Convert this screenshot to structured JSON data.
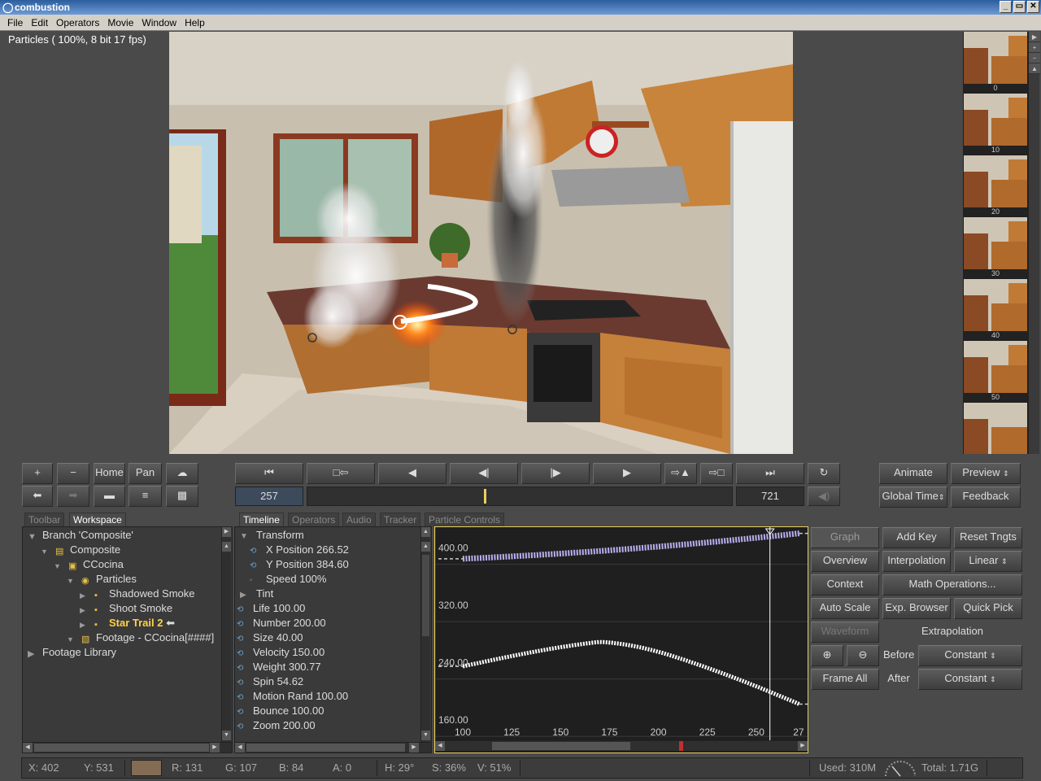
{
  "app": {
    "title": "combustion"
  },
  "menu": [
    "File",
    "Edit",
    "Operators",
    "Movie",
    "Window",
    "Help"
  ],
  "viewer": {
    "info": "Particles ( 100%, 8 bit  17 fps)"
  },
  "thumbnails": {
    "labels": [
      "0",
      "10",
      "20",
      "30",
      "40",
      "50"
    ]
  },
  "viewer_tools": {
    "home": "Home",
    "pan": "Pan",
    "plus": "+",
    "minus": "−"
  },
  "transport": {
    "current_frame": "257",
    "end_frame": "721",
    "current_frame_fraction": 0.416
  },
  "right_buttons": {
    "animate": "Animate",
    "preview": "Preview",
    "global_time": "Global Time",
    "feedback": "Feedback"
  },
  "workspace": {
    "tabs": [
      "Toolbar",
      "Workspace"
    ],
    "tree": [
      {
        "label": "Branch 'Composite'",
        "indent": 0,
        "icon": "triangle-down-icon"
      },
      {
        "label": "Composite",
        "indent": 1,
        "icon": "composite-icon"
      },
      {
        "label": "CCocina",
        "indent": 2,
        "icon": "layer-icon"
      },
      {
        "label": "Particles",
        "indent": 3,
        "icon": "particle-icon"
      },
      {
        "label": "Shadowed Smoke",
        "indent": 4,
        "icon": "emitter-icon"
      },
      {
        "label": "Shoot Smoke",
        "indent": 4,
        "icon": "emitter-icon"
      },
      {
        "label": "Star Trail 2",
        "indent": 4,
        "icon": "emitter-icon",
        "selected": true
      },
      {
        "label": "Footage - CCocina[####]",
        "indent": 3,
        "icon": "footage-icon"
      },
      {
        "label": "Footage Library",
        "indent": 0,
        "icon": "triangle-right-icon"
      }
    ]
  },
  "timeline": {
    "tabs": [
      "Timeline",
      "Operators",
      "Audio",
      "Tracker",
      "Particle Controls"
    ],
    "rows": [
      {
        "label": "Transform",
        "kind": "group"
      },
      {
        "label": "X Position  266.52",
        "kind": "sub"
      },
      {
        "label": "Y Position  384.60",
        "kind": "sub"
      },
      {
        "label": "Speed  100%",
        "kind": "sub2"
      },
      {
        "label": "Tint",
        "kind": "group"
      },
      {
        "label": "Life  100.00",
        "kind": "param"
      },
      {
        "label": "Number  200.00",
        "kind": "param"
      },
      {
        "label": "Size  40.00",
        "kind": "param"
      },
      {
        "label": "Velocity  150.00",
        "kind": "param"
      },
      {
        "label": "Weight  300.77",
        "kind": "param"
      },
      {
        "label": "Spin  54.62",
        "kind": "param"
      },
      {
        "label": "Motion Rand  100.00",
        "kind": "param"
      },
      {
        "label": "Bounce  100.00",
        "kind": "param"
      },
      {
        "label": "Zoom  200.00",
        "kind": "param"
      }
    ]
  },
  "graph": {
    "y_ticks": [
      "400.00",
      "320.00",
      "240.00",
      "160.00"
    ],
    "x_ticks": [
      "100",
      "125",
      "150",
      "175",
      "200",
      "225",
      "250",
      "27"
    ],
    "curve_x_label": "X Position",
    "curve_y_label": "Y Position",
    "current_time_frame": 257
  },
  "graph_controls": {
    "graph": "Graph",
    "add_key": "Add Key",
    "reset_tangents": "Reset Tngts",
    "overview": "Overview",
    "interpolation": "Interpolation",
    "linear": "Linear",
    "context": "Context",
    "math_operations": "Math Operations...",
    "auto_scale": "Auto Scale",
    "exp_browser": "Exp. Browser",
    "quick_pick": "Quick Pick",
    "waveform": "Waveform",
    "extrapolation": "Extrapolation",
    "before": "Before",
    "before_value": "Constant",
    "frame_all": "Frame All",
    "after": "After",
    "after_value": "Constant"
  },
  "status": {
    "x": "X:  402",
    "y": "Y:  531",
    "swatch_color": "#836b54",
    "r": "R: 131",
    "g": "G: 107",
    "b": "B: 84",
    "a": "A: 0",
    "h": "H: 29°",
    "s": "S: 36%",
    "v": "V: 51%",
    "used": "Used: 310M",
    "total": "Total: 1.71G"
  },
  "colors": {
    "accent_yellow": "#e8d060",
    "selected_text": "#ffd24a",
    "curve_x": "#b8b0f0",
    "curve_y": "#ffffff"
  }
}
